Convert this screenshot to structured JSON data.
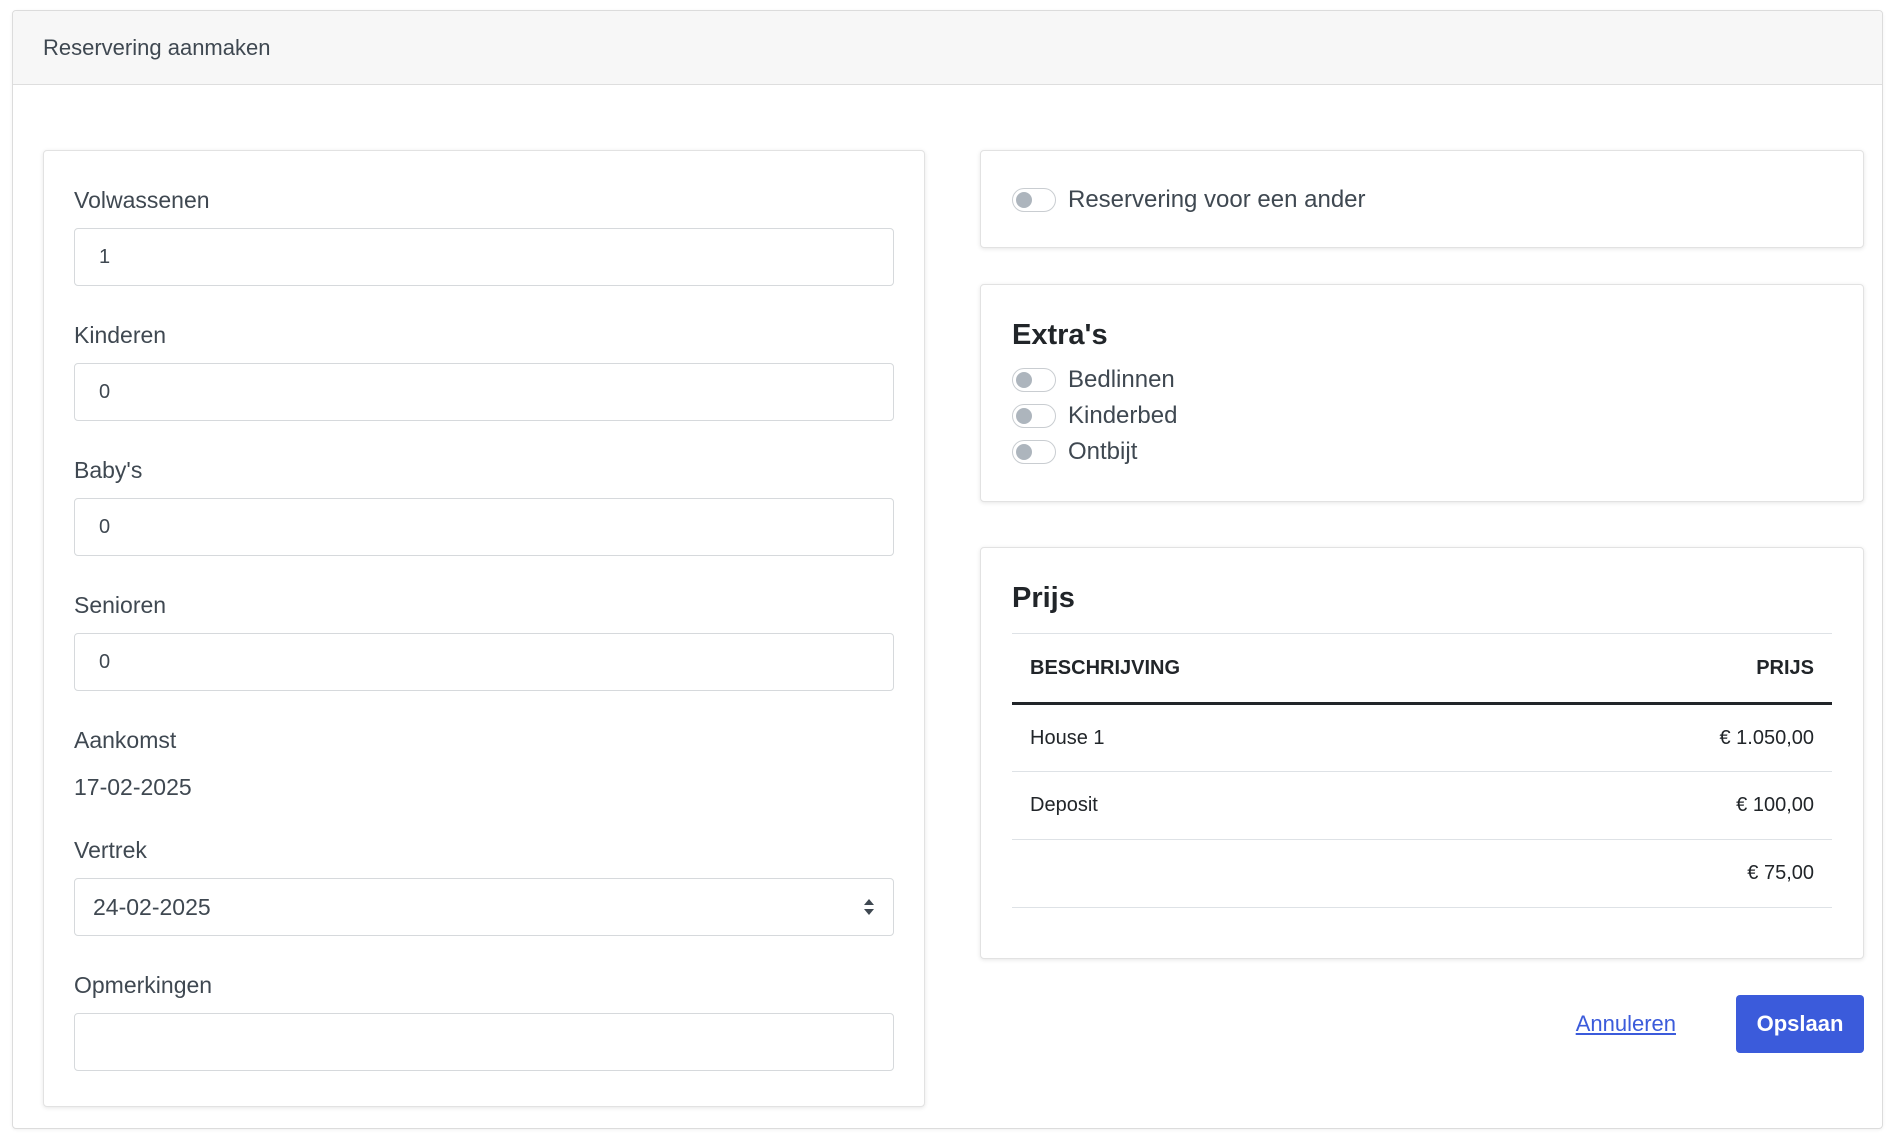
{
  "header": {
    "title": "Reservering aanmaken"
  },
  "form": {
    "adults_label": "Volwassenen",
    "adults_value": "1",
    "children_label": "Kinderen",
    "children_value": "0",
    "babies_label": "Baby's",
    "babies_value": "0",
    "seniors_label": "Senioren",
    "seniors_value": "0",
    "arrival_label": "Aankomst",
    "arrival_value": "17-02-2025",
    "departure_label": "Vertrek",
    "departure_value": "24-02-2025",
    "remarks_label": "Opmerkingen",
    "remarks_value": ""
  },
  "other_booking": {
    "label": "Reservering voor een ander",
    "checked": false
  },
  "extras": {
    "title": "Extra's",
    "items": [
      {
        "label": "Bedlinnen",
        "checked": false
      },
      {
        "label": "Kinderbed",
        "checked": false
      },
      {
        "label": "Ontbijt",
        "checked": false
      }
    ]
  },
  "price": {
    "title": "Prijs",
    "col_description": "Beschrijving",
    "col_price": "Prijs",
    "rows": [
      {
        "description": "House 1",
        "price": "€ 1.050,00"
      },
      {
        "description": "Deposit",
        "price": "€ 100,00"
      },
      {
        "description": "",
        "price": "€ 75,00"
      }
    ]
  },
  "actions": {
    "cancel_label": "Annuleren",
    "save_label": "Opslaan"
  },
  "colors": {
    "accent": "#3b5bdb",
    "header_bg": "#f7f7f7"
  },
  "icons": {
    "select_arrows": "sort-arrows-icon"
  }
}
